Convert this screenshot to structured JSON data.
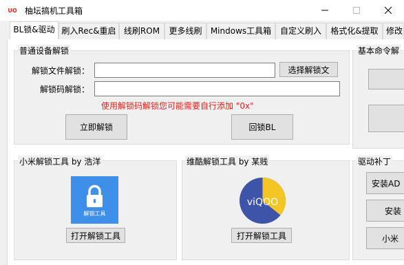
{
  "window": {
    "title": "柚坛搞机工具箱",
    "app_icon_text": "UO"
  },
  "tabs": [
    {
      "label": "BL锁&驱动"
    },
    {
      "label": "刷入Rec&重启"
    },
    {
      "label": "线刷ROM"
    },
    {
      "label": "更多线刷"
    },
    {
      "label": "Mindows工具箱"
    },
    {
      "label": "自定义刷入"
    },
    {
      "label": "格式化&提取"
    },
    {
      "label": "修改"
    }
  ],
  "unlock_group": {
    "title": "普通设备解锁",
    "file_label": "解锁文件解锁：",
    "file_value": "",
    "browse_button": "选择解锁文",
    "code_label": "解锁码解锁：",
    "code_value": "",
    "warning": "使用解锁码解锁您可能需要自行添加 \"0x\"",
    "unlock_button": "立即解锁",
    "relock_button": "回锁BL"
  },
  "basic_cmd_group": {
    "title": "基本命令解"
  },
  "xiaomi_group": {
    "title": "小米解锁工具 by 浩洋",
    "icon_label": "解锁工具",
    "open_button": "打开解锁工具"
  },
  "vivo_group": {
    "title": "维酷解锁工具 by 某贱",
    "icon_label": "viQOO",
    "open_button": "打开解锁工具"
  },
  "driver_group": {
    "title": "驱动补丁",
    "buttons": [
      "安装AD",
      "安装",
      "小米"
    ]
  }
}
